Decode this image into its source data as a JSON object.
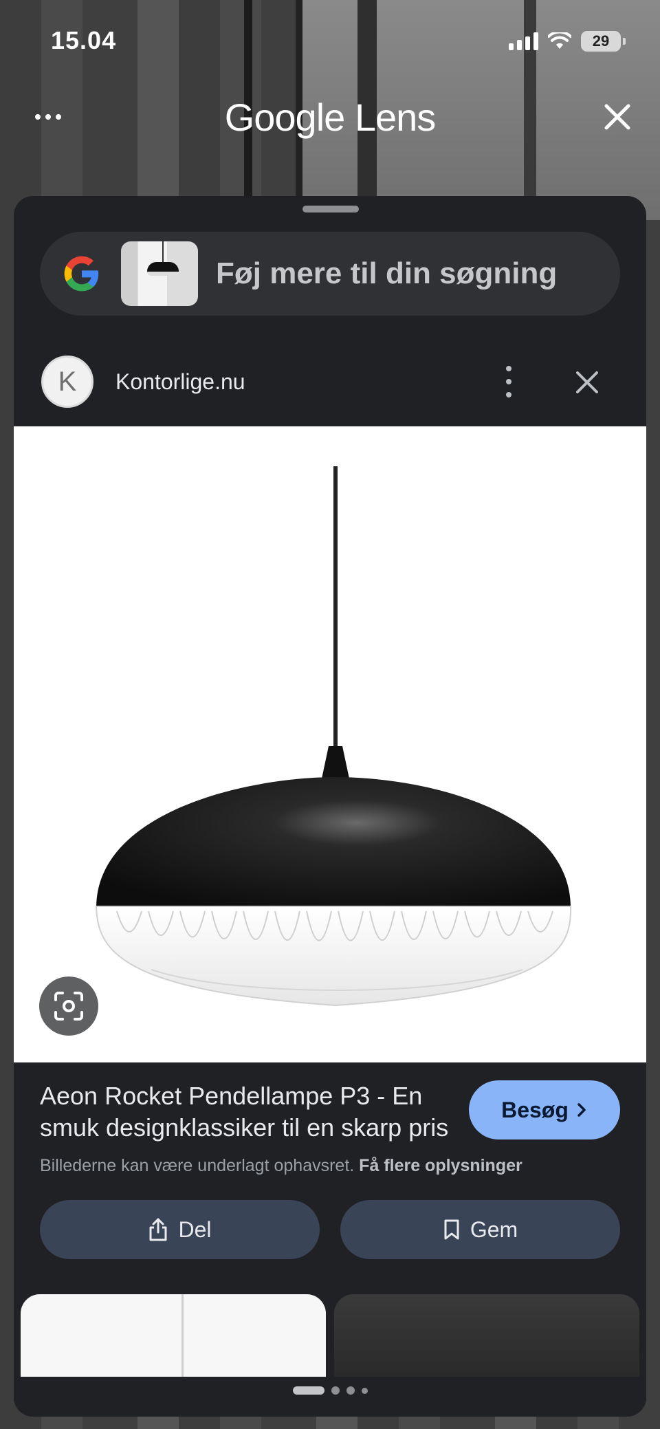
{
  "status_bar": {
    "time": "15.04",
    "battery": "29"
  },
  "topbar": {
    "title": "Google Lens"
  },
  "search": {
    "placeholder": "Føj mere til din søgning"
  },
  "source": {
    "name": "Kontorlige.nu",
    "favicon_letter": "K"
  },
  "result": {
    "title": "Aeon Rocket Pendellampe P3 - En smuk designklassiker til en skarp pris",
    "visit_label": "Besøg",
    "copyright_text": "Billederne kan være underlagt ophavsret.",
    "copyright_link": "Få flere oplysninger",
    "share_label": "Del",
    "save_label": "Gem"
  },
  "colors": {
    "sheet": "#202124",
    "visit_button": "#8ab4f8",
    "action_button": "#394457"
  }
}
